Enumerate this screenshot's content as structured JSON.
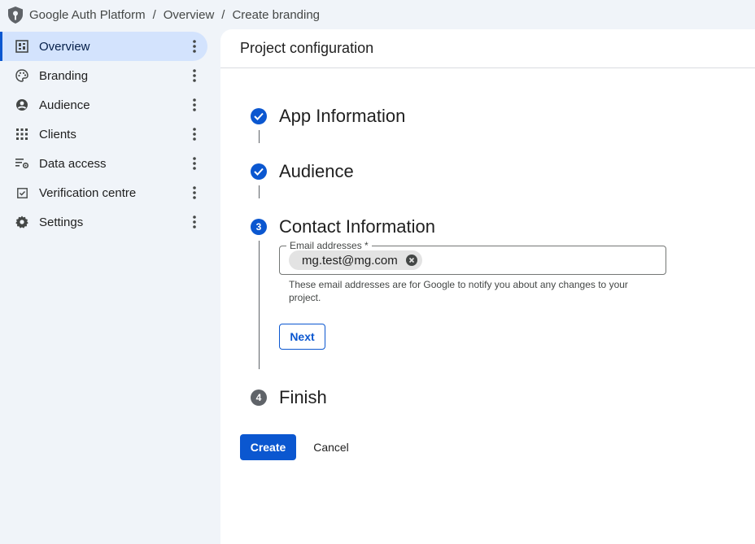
{
  "breadcrumb": {
    "items": [
      "Google Auth Platform",
      "Overview",
      "Create branding"
    ],
    "separator": "/"
  },
  "sidebar": {
    "items": [
      {
        "label": "Overview",
        "icon": "dashboard-icon",
        "active": true
      },
      {
        "label": "Branding",
        "icon": "palette-icon",
        "active": false
      },
      {
        "label": "Audience",
        "icon": "account-circle-icon",
        "active": false
      },
      {
        "label": "Clients",
        "icon": "apps-grid-icon",
        "active": false
      },
      {
        "label": "Data access",
        "icon": "data-settings-icon",
        "active": false
      },
      {
        "label": "Verification centre",
        "icon": "checkbox-icon",
        "active": false
      },
      {
        "label": "Settings",
        "icon": "gear-icon",
        "active": false
      }
    ]
  },
  "main": {
    "title": "Project configuration",
    "steps": [
      {
        "title": "App Information",
        "state": "done",
        "number": ""
      },
      {
        "title": "Audience",
        "state": "done",
        "number": ""
      },
      {
        "title": "Contact Information",
        "state": "current",
        "number": "3"
      },
      {
        "title": "Finish",
        "state": "pending",
        "number": "4"
      }
    ],
    "email_field": {
      "label": "Email addresses *",
      "chips": [
        "mg.test@mg.com"
      ],
      "helper": "These email addresses are for Google to notify you about any changes to your project."
    },
    "next_label": "Next",
    "create_label": "Create",
    "cancel_label": "Cancel"
  },
  "colors": {
    "accent": "#0b57d0",
    "nav_active_bg": "#d3e3fd",
    "page_bg": "#f0f4f9",
    "step_pending": "#5f6368"
  }
}
